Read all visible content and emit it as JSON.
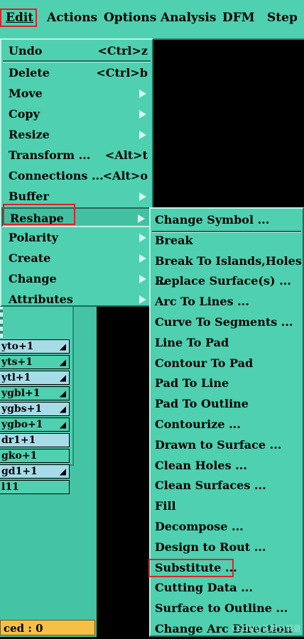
{
  "menubar": {
    "items": [
      "Edit",
      "Actions",
      "Options",
      "Analysis",
      "DFM",
      "Step"
    ]
  },
  "edit_menu": {
    "items": [
      {
        "label": "Undo",
        "accel": "<Ctrl>z"
      },
      {
        "label": "Delete",
        "accel": "<Ctrl>b"
      },
      {
        "label": "Move",
        "accel": ""
      },
      {
        "label": "Copy",
        "accel": ""
      },
      {
        "label": "Resize",
        "accel": ""
      },
      {
        "label": "Transform ...",
        "accel": "<Alt>t"
      },
      {
        "label": "Connections ...",
        "accel": "<Alt>o"
      },
      {
        "label": "Buffer",
        "accel": ""
      },
      {
        "label": "Reshape",
        "accel": ""
      },
      {
        "label": "Polarity",
        "accel": ""
      },
      {
        "label": "Create",
        "accel": ""
      },
      {
        "label": "Change",
        "accel": ""
      },
      {
        "label": "Attributes",
        "accel": ""
      }
    ]
  },
  "reshape_menu": {
    "items": [
      "Change Symbol ...",
      "Break",
      "Break To Islands,Holes ...",
      "Replace Surface(s) ...",
      "Arc To Lines ...",
      "Curve To Segments ...",
      "Line To Pad",
      "Contour To Pad",
      "Pad To Line",
      "Pad To Outline",
      "Contourize ...",
      "Drawn to Surface ...",
      "Clean Holes ...",
      "Clean Surfaces ...",
      "Fill",
      "Decompose ...",
      "Design to Rout ...",
      "Substitute ...",
      "Cutting Data ...",
      "Surface to Outline ...",
      "Change Arc Direction"
    ]
  },
  "layers": [
    {
      "name": "yto+1",
      "locked": true
    },
    {
      "name": "yts+1",
      "locked": true
    },
    {
      "name": "ytl+1",
      "locked": true
    },
    {
      "name": "ygbl+1",
      "locked": true
    },
    {
      "name": "ygbs+1",
      "locked": true
    },
    {
      "name": "ygbo+1",
      "locked": true
    },
    {
      "name": "dr1+1",
      "locked": false
    },
    {
      "name": "gko+1",
      "locked": false
    },
    {
      "name": "gd1+1",
      "locked": true
    },
    {
      "name": "l11",
      "locked": false
    }
  ],
  "status": {
    "text": "ced : 0"
  },
  "watermark": "CSDN@沉思分解意"
}
